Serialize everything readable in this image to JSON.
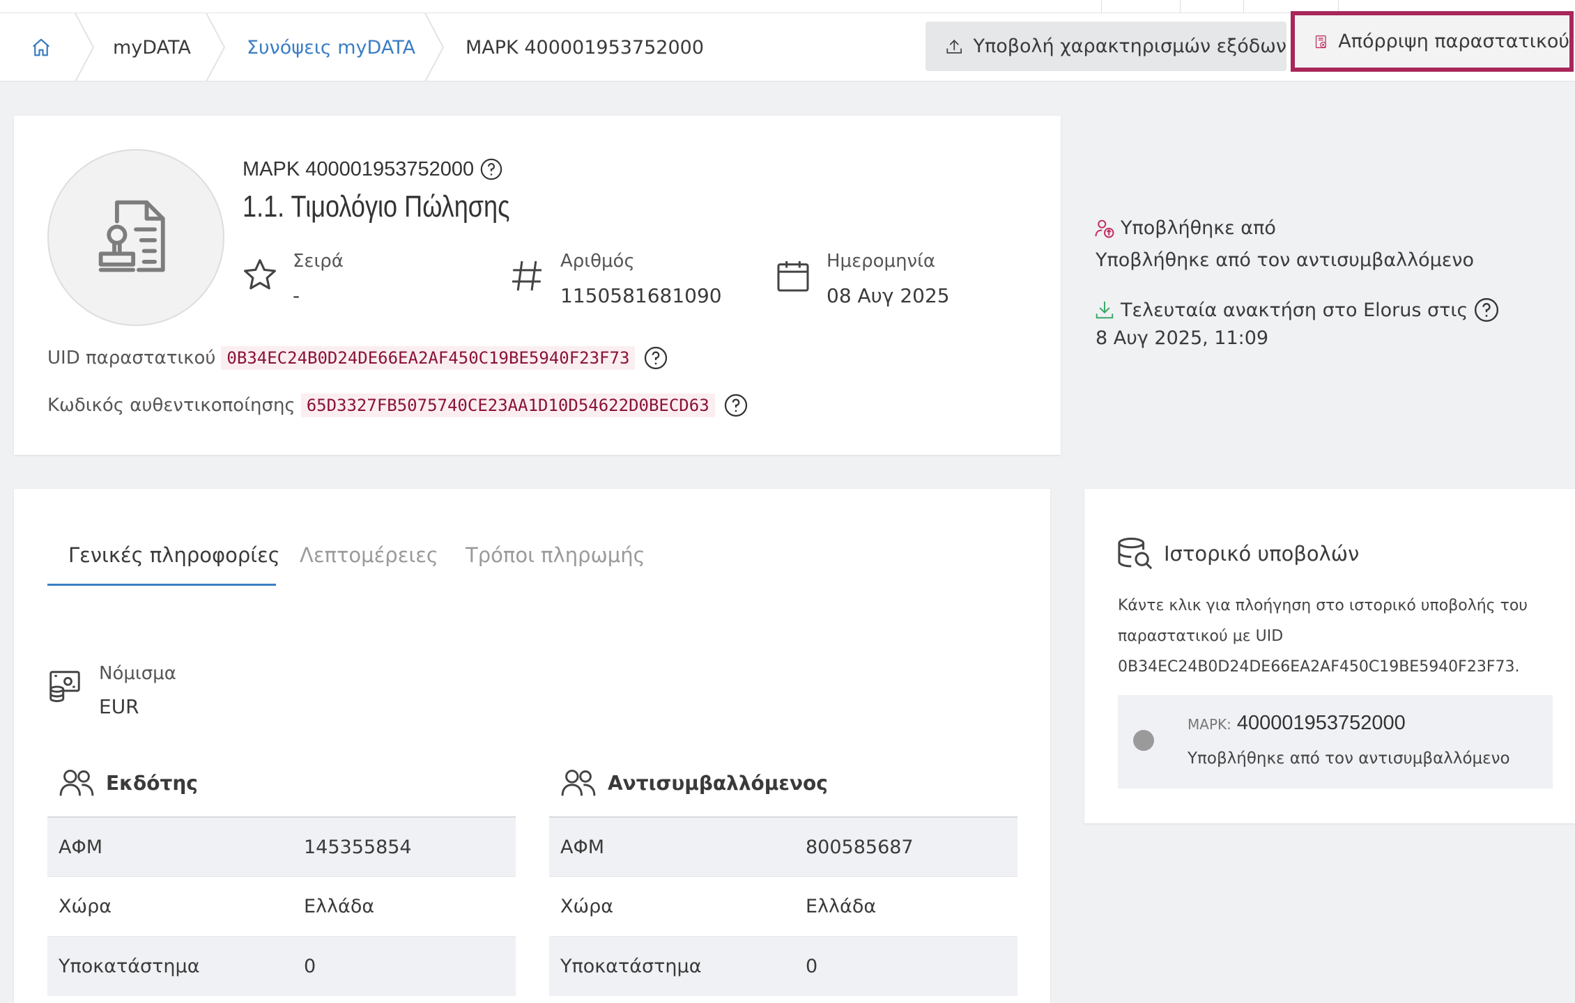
{
  "breadcrumb": {
    "home_icon": "home-icon",
    "items": [
      "myDATA",
      "Συνόψεις myDATA",
      "ΜΑΡΚ 400001953752000"
    ]
  },
  "toolbar": {
    "submit_label": "Υποβολή χαρακτηρισμών εξόδων",
    "reject_label": "Απόρριψη παραστατικού",
    "highlight_color": "#a8265a"
  },
  "document": {
    "mark_line": "ΜΑΡΚ 400001953752000",
    "title": "1.1. Τιμολόγιο Πώλησης",
    "series_label": "Σειρά",
    "series_value": "-",
    "number_label": "Αριθμός",
    "number_value": "1150581681090",
    "date_label": "Ημερομηνία",
    "date_value": "08 Αυγ 2025",
    "uid_label": "UID παραστατικού",
    "uid_value": "0B34EC24B0D24DE66EA2AF450C19BE5940F23F73",
    "auth_label": "Κωδικός αυθεντικοποίησης",
    "auth_value": "65D3327FB5075740CE23AA1D10D54622D0BECD63"
  },
  "submission": {
    "submitted_by_label": "Υποβλήθηκε από",
    "submitted_by_value": "Υποβλήθηκε από τον αντισυμβαλλόμενο",
    "retrieved_label": "Τελευταία ανακτήση στο Elorus στις",
    "retrieved_value": "8 Αυγ 2025, 11:09"
  },
  "tabs": [
    "Γενικές πληροφορίες",
    "Λεπτομέρειες",
    "Τρόποι πληρωμής"
  ],
  "currency": {
    "label": "Νόμισμα",
    "value": "EUR"
  },
  "issuer": {
    "title": "Εκδότης",
    "rows": [
      {
        "key": "ΑΦΜ",
        "value": "145355854"
      },
      {
        "key": "Χώρα",
        "value": "Ελλάδα"
      },
      {
        "key": "Υποκατάστημα",
        "value": "0"
      }
    ]
  },
  "counterpart": {
    "title": "Αντισυμβαλλόμενος",
    "rows": [
      {
        "key": "ΑΦΜ",
        "value": "800585687"
      },
      {
        "key": "Χώρα",
        "value": "Ελλάδα"
      },
      {
        "key": "Υποκατάστημα",
        "value": "0"
      }
    ]
  },
  "history": {
    "title": "Ιστορικό υποβολών",
    "description_line1": "Κάντε κλικ για πλοήγηση στο ιστορικό υποβολής του",
    "description_line2": "παραστατικού με UID",
    "description_line3": "0B34EC24B0D24DE66EA2AF450C19BE5940F23F73.",
    "item_prefix": "ΜΑΡΚ:",
    "item_mark": "400001953752000",
    "item_subtitle": "Υποβλήθηκε από τον αντισυμβαλλόμενο"
  }
}
